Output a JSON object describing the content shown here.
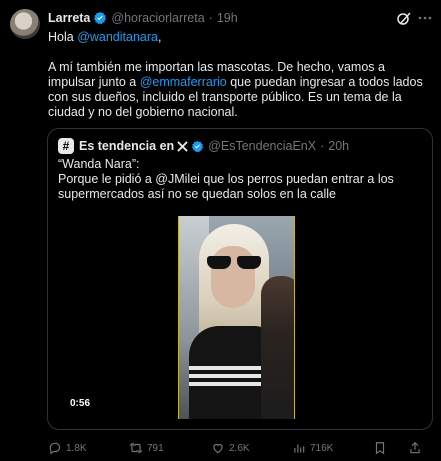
{
  "author": {
    "name": "Larreta",
    "handle": "@horaciorlarreta",
    "dot": "·",
    "time": "19h"
  },
  "post": {
    "line1_prefix": "Hola ",
    "line1_mention": "@wanditanara",
    "line1_suffix": ",",
    "para2_a": "A mí también me importan  las mascotas. De hecho, vamos a impulsar junto a ",
    "para2_mention": "@emmaferrario",
    "para2_b": " que puedan ingresar a todos lados con sus dueños, incluido el transporte público. Es un tema de la ciudad y no del gobierno nacional."
  },
  "quote": {
    "avatar_glyph": "#",
    "name": "Es tendencia en",
    "handle": "@EsTendenciaEnX",
    "dot": "·",
    "time": "20h",
    "text_line1": "“Wanda Nara”:",
    "text_line2": "Porque le pidió a @JMilei que los perros puedan entrar a los supermercados así no se quedan solos en la calle",
    "video_duration": "0:56"
  },
  "actions": {
    "replies": "1.8K",
    "retweets": "791",
    "likes": "2.6K",
    "views": "716K"
  },
  "icons": [
    "verified-icon",
    "grok-icon",
    "more-icon",
    "x-logo-icon",
    "reply-icon",
    "retweet-icon",
    "like-icon",
    "views-icon",
    "bookmark-icon",
    "share-icon"
  ],
  "colors": {
    "background": "#000000",
    "text": "#e7e9ea",
    "muted": "#71767b",
    "accent": "#1d9bf0",
    "border": "#2f3336"
  }
}
